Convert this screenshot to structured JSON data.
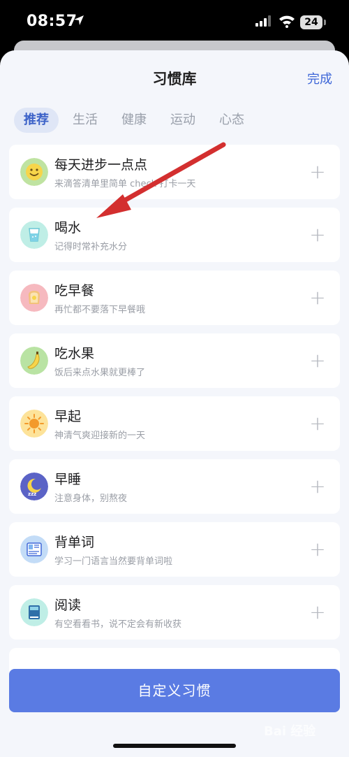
{
  "status_bar": {
    "time": "08:57",
    "battery": "24"
  },
  "header": {
    "title": "习惯库",
    "done_label": "完成"
  },
  "tabs": [
    {
      "label": "推荐",
      "active": true
    },
    {
      "label": "生活",
      "active": false
    },
    {
      "label": "健康",
      "active": false
    },
    {
      "label": "运动",
      "active": false
    },
    {
      "label": "心态",
      "active": false
    }
  ],
  "habits": [
    {
      "title": "每天进步一点点",
      "subtitle": "来滴答清单里简单 check 打卡一天",
      "icon": "smiley-icon",
      "icon_color": "#bfe3a1"
    },
    {
      "title": "喝水",
      "subtitle": "记得时常补充水分",
      "icon": "water-glass-icon",
      "icon_color": "#bfeee6"
    },
    {
      "title": "吃早餐",
      "subtitle": "再忙都不要落下早餐哦",
      "icon": "toast-icon",
      "icon_color": "#f6b9bf"
    },
    {
      "title": "吃水果",
      "subtitle": "饭后来点水果就更棒了",
      "icon": "banana-icon",
      "icon_color": "#b9e3a3"
    },
    {
      "title": "早起",
      "subtitle": "神清气爽迎接新的一天",
      "icon": "sun-icon",
      "icon_color": "#fde39a"
    },
    {
      "title": "早睡",
      "subtitle": "注意身体，别熬夜",
      "icon": "moon-icon",
      "icon_color": "#5b63c6"
    },
    {
      "title": "背单词",
      "subtitle": "学习一门语言当然要背单词啦",
      "icon": "book-icon",
      "icon_color": "#c3dcf7"
    },
    {
      "title": "阅读",
      "subtitle": "有空看看书，说不定会有新收获",
      "icon": "reading-book-icon",
      "icon_color": "#bfeee6"
    }
  ],
  "cta": {
    "label": "自定义习惯"
  },
  "watermark": "Bai 经验",
  "accent_color": "#3e67d8",
  "annotation_arrow_color": "#d32f2f"
}
